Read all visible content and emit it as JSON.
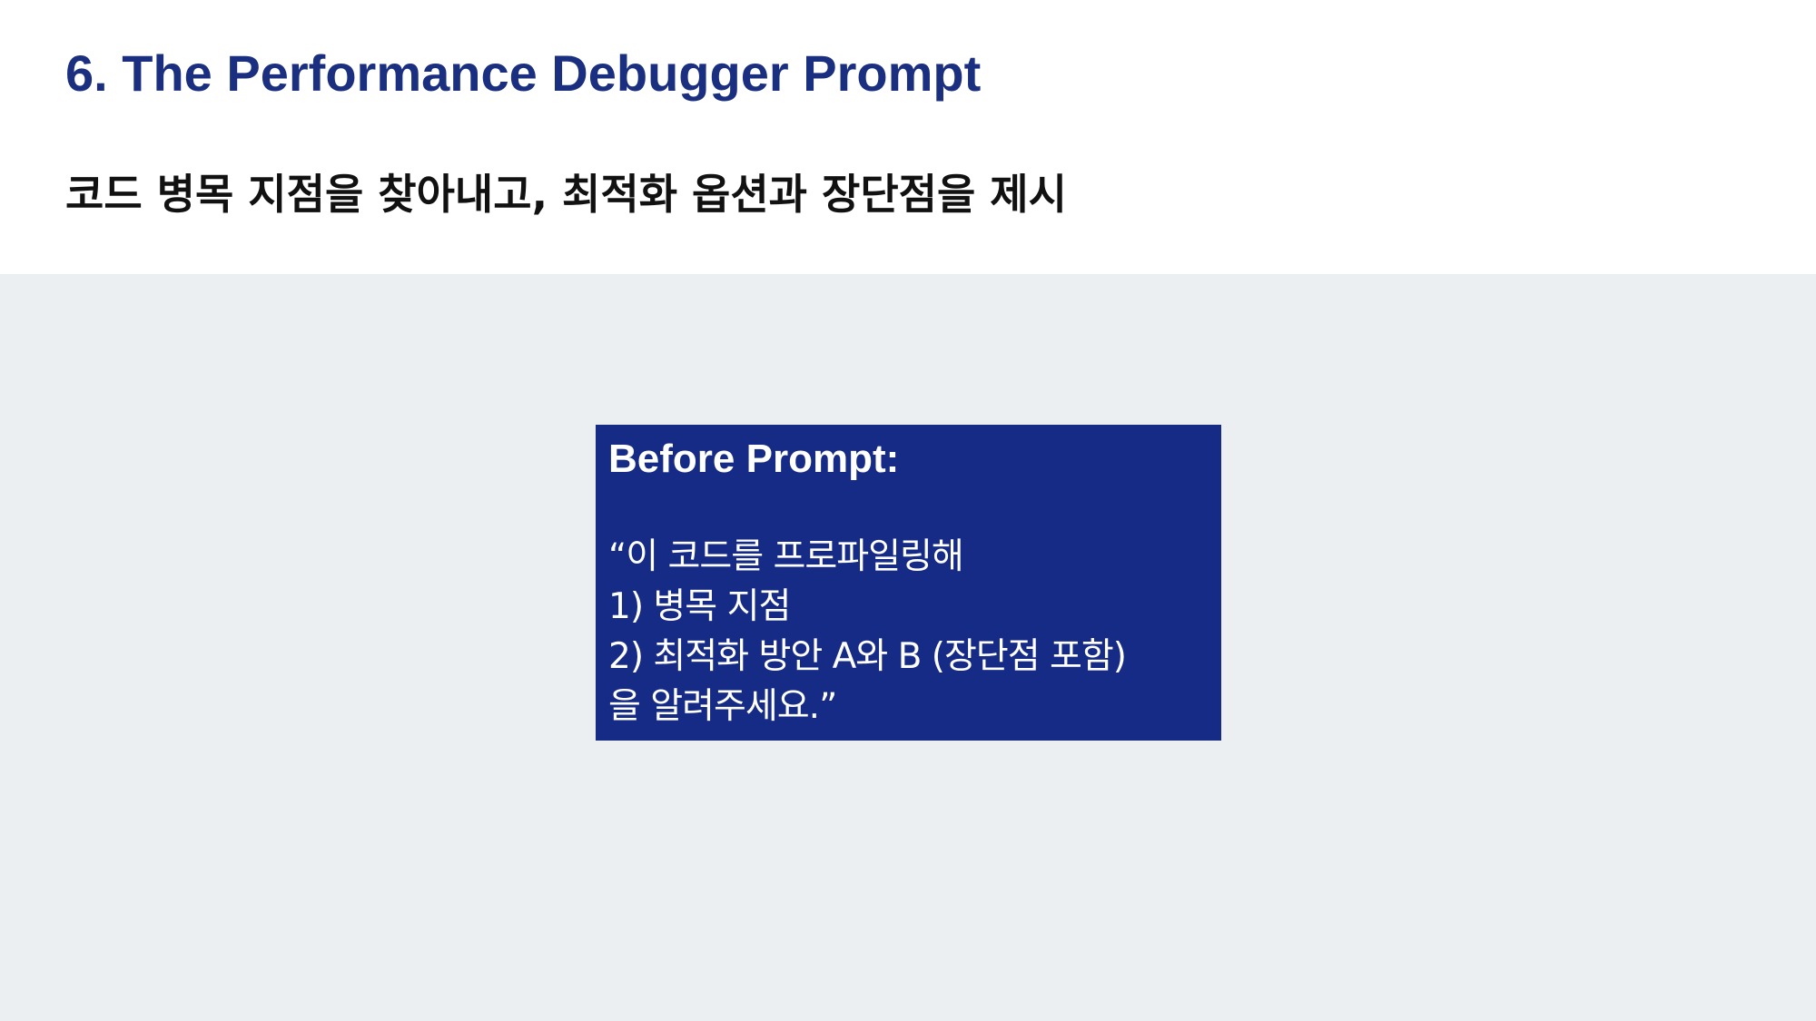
{
  "slide": {
    "title": "6. The Performance Debugger Prompt",
    "subtitle": "코드 병목 지점을 찾아내고, 최적화 옵션과 장단점을 제시"
  },
  "prompt_box": {
    "heading": "Before Prompt:",
    "lines": [
      "“이 코드를 프로파일링해",
      "1) 병목 지점",
      "2) 최적화 방안 A와 B (장단점 포함)",
      "을 알려주세요.”"
    ]
  },
  "colors": {
    "title": "#1b2f80",
    "box_background": "#162b85",
    "content_background": "#ebeff2"
  }
}
